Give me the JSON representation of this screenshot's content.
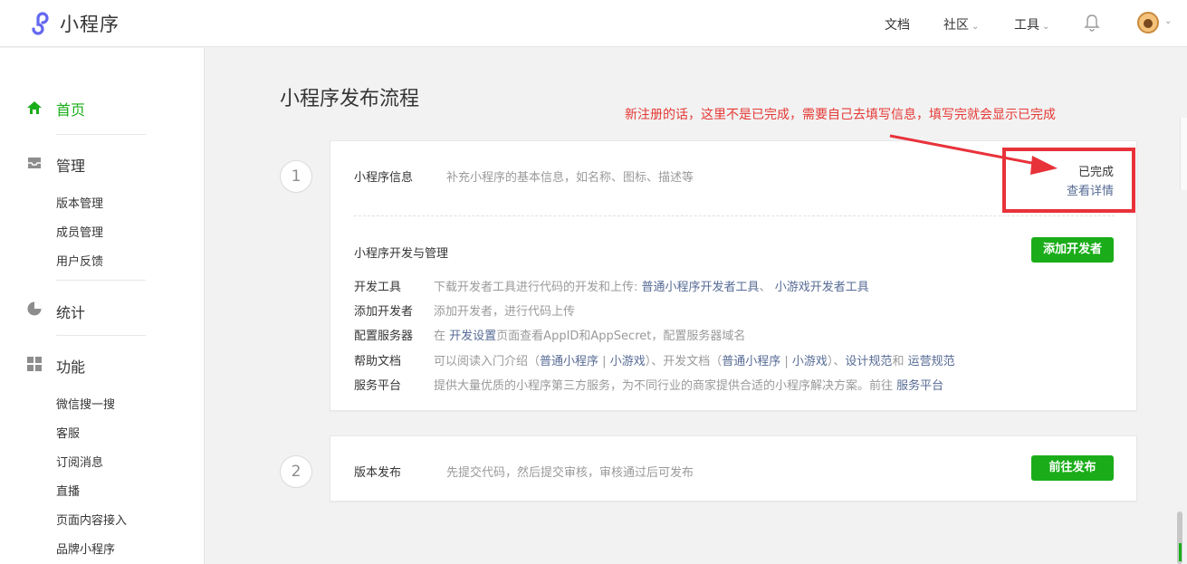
{
  "header": {
    "brand": "小程序",
    "nav": [
      {
        "label": "文档",
        "has_dropdown": false
      },
      {
        "label": "社区",
        "has_dropdown": true
      },
      {
        "label": "工具",
        "has_dropdown": true
      }
    ],
    "bell_icon": "bell-icon",
    "avatar_icon": "avatar"
  },
  "sidebar": {
    "home": "首页",
    "manage": "管理",
    "manage_items": [
      "版本管理",
      "成员管理",
      "用户反馈"
    ],
    "stats": "统计",
    "features": "功能",
    "feature_items": [
      "微信搜一搜",
      "客服",
      "订阅消息",
      "直播",
      "页面内容接入",
      "品牌小程序"
    ]
  },
  "main": {
    "title": "小程序发布流程",
    "annotation": "新注册的话，这里不是已完成，需要自己去填写信息，填写完就会显示已完成",
    "step1": {
      "number": "1",
      "info_label": "小程序信息",
      "info_desc": "补充小程序的基本信息，如名称、图标、描述等",
      "status": "已完成",
      "detail_link": "查看详情",
      "dev_title": "小程序开发与管理",
      "add_dev_button": "添加开发者",
      "rows": [
        {
          "label": "开发工具",
          "text": "下载开发者工具进行代码的开发和上传:",
          "link1": "普通小程序开发者工具",
          "sep": "、",
          "link2": "小游戏开发者工具"
        },
        {
          "label": "添加开发者",
          "text": "添加开发者，进行代码上传"
        },
        {
          "label": "配置服务器",
          "pre": "在",
          "link": "开发设置",
          "post": "页面查看AppID和AppSecret，配置服务器域名"
        },
        {
          "label": "帮助文档",
          "pre": "可以阅读入门介绍（",
          "l1": "普通小程序",
          "bar1": " | ",
          "l2": "小游戏",
          "mid": "）、开发文档（",
          "l3": "普通小程序",
          "bar2": " | ",
          "l4": "小游戏",
          "mid2": "）、",
          "l5": "设计规范",
          "and": "和",
          "l6": "运营规范"
        },
        {
          "label": "服务平台",
          "text": "提供大量优质的小程序第三方服务，为不同行业的商家提供合适的小程序解决方案。前往",
          "link": "服务平台"
        }
      ]
    },
    "step2": {
      "number": "2",
      "label": "版本发布",
      "desc": "先提交代码，然后提交审核，审核通过后可发布",
      "button": "前往发布"
    }
  },
  "colors": {
    "accent_green": "#1aad19",
    "link_blue": "#576b95",
    "annotation_red": "#e53935"
  }
}
